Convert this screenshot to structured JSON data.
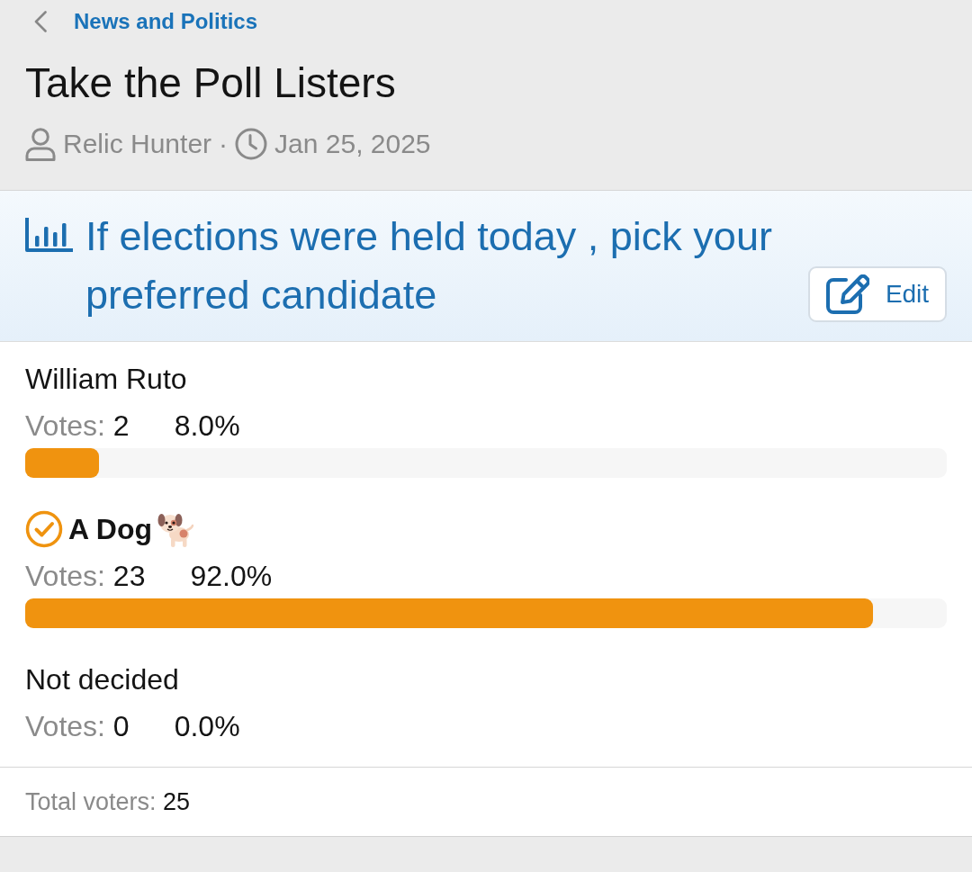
{
  "breadcrumb": {
    "label": "News and Politics"
  },
  "thread": {
    "title": "Take the Poll Listers",
    "author": "Relic Hunter",
    "separator": "·",
    "date": "Jan 25, 2025"
  },
  "poll": {
    "question": "If elections were held today , pick your preferred candidate",
    "edit_button": "Edit",
    "options": [
      {
        "label": "William Ruto",
        "selected": false,
        "emoji": false,
        "votes_label": "Votes:",
        "votes": "2",
        "percent": "8.0%",
        "level": 0.08
      },
      {
        "label": "A Dog",
        "selected": true,
        "emoji": true,
        "votes_label": "Votes:",
        "votes": "23",
        "percent": "92.0%",
        "level": 0.92
      },
      {
        "label": "Not decided",
        "selected": false,
        "emoji": false,
        "votes_label": "Votes:",
        "votes": "0",
        "percent": "0.0%"
      }
    ],
    "total": {
      "label": "Total voters:",
      "value": "25"
    }
  }
}
